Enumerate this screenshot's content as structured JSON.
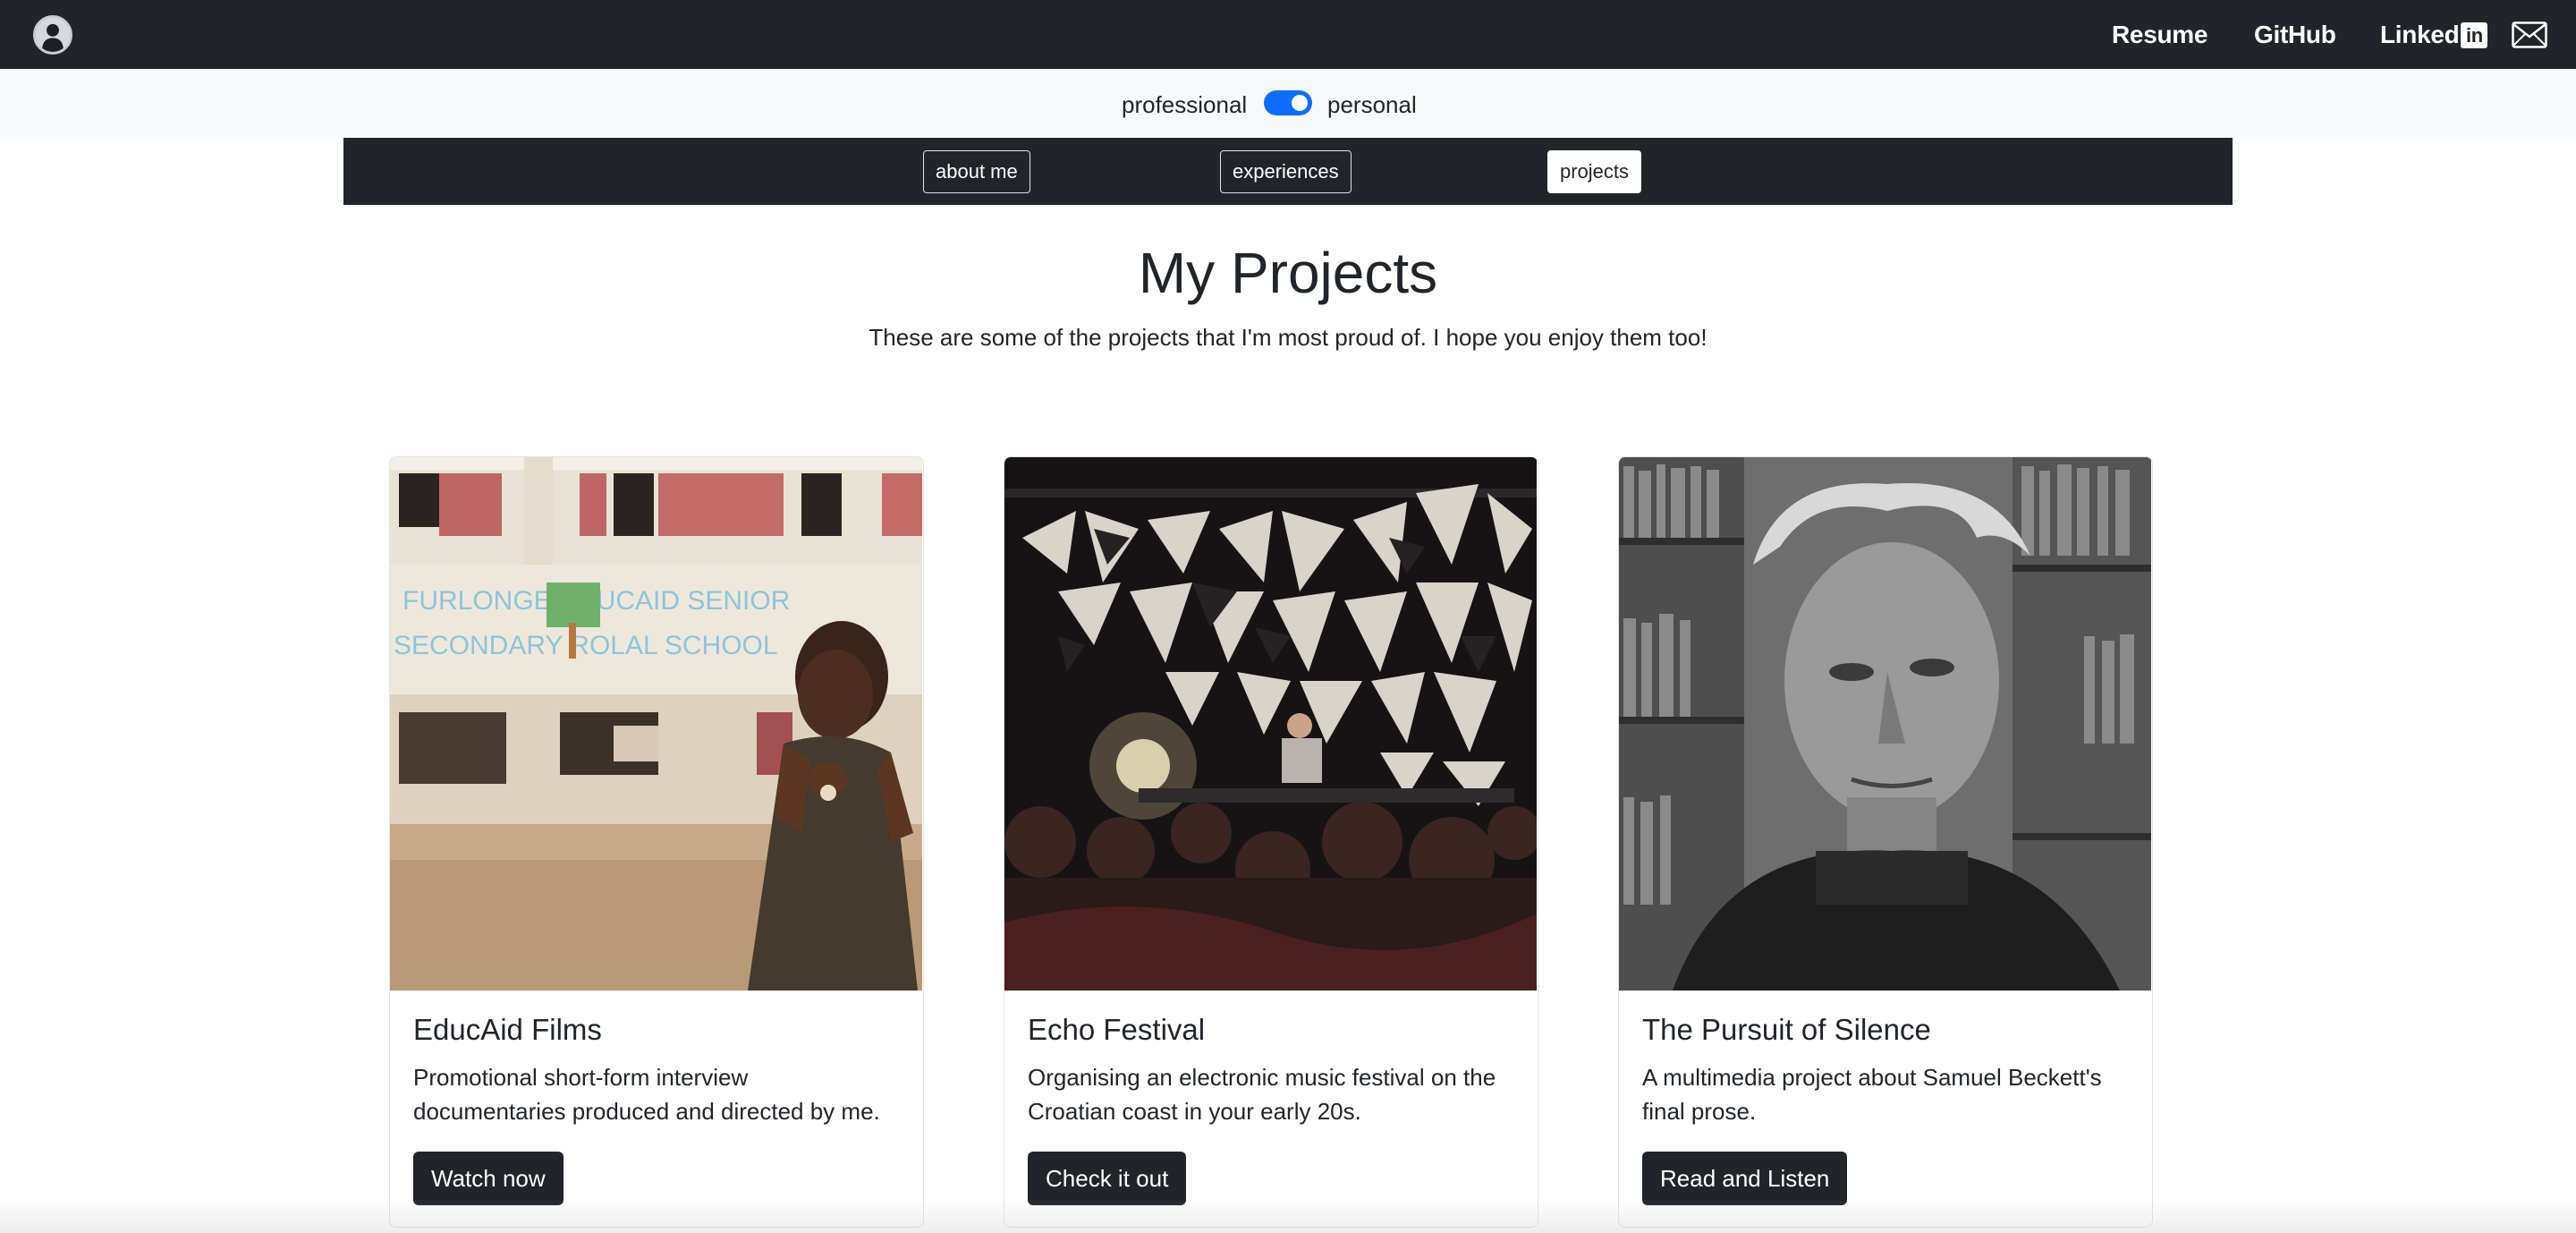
{
  "nav": {
    "avatar_icon": "user-avatar-icon",
    "links": {
      "resume": "Resume",
      "github": "GitHub",
      "linkedin_text": "Linked",
      "linkedin_box": "in"
    },
    "mail_icon": "envelope-icon"
  },
  "toggle": {
    "left_label": "professional",
    "right_label": "personal",
    "state": "personal",
    "accent": "#0d6efd"
  },
  "sections": {
    "about": "about me",
    "experiences": "experiences",
    "projects": "projects",
    "active": "projects"
  },
  "header": {
    "title": "My Projects",
    "subtitle": "These are some of the projects that I'm most proud of. I hope you enjoy them too!"
  },
  "projects": [
    {
      "title": "EducAid Films",
      "description": "Promotional short-form interview documentaries produced and directed by me.",
      "button": "Watch now",
      "image": {
        "sign_line1": "FURLONGE      EDUCAID  SENIOR",
        "sign_line2": "SECONDARY  ROLAL   SCHOOL"
      }
    },
    {
      "title": "Echo Festival",
      "description": "Organising an electronic music festival on the Croatian coast in your early 20s.",
      "button": "Check it out"
    },
    {
      "title": "The Pursuit of Silence",
      "description": "A multimedia project about Samuel Beckett's final prose.",
      "button": "Read and Listen"
    }
  ],
  "colors": {
    "dark": "#212529",
    "light_strip": "#f8f9fa"
  }
}
